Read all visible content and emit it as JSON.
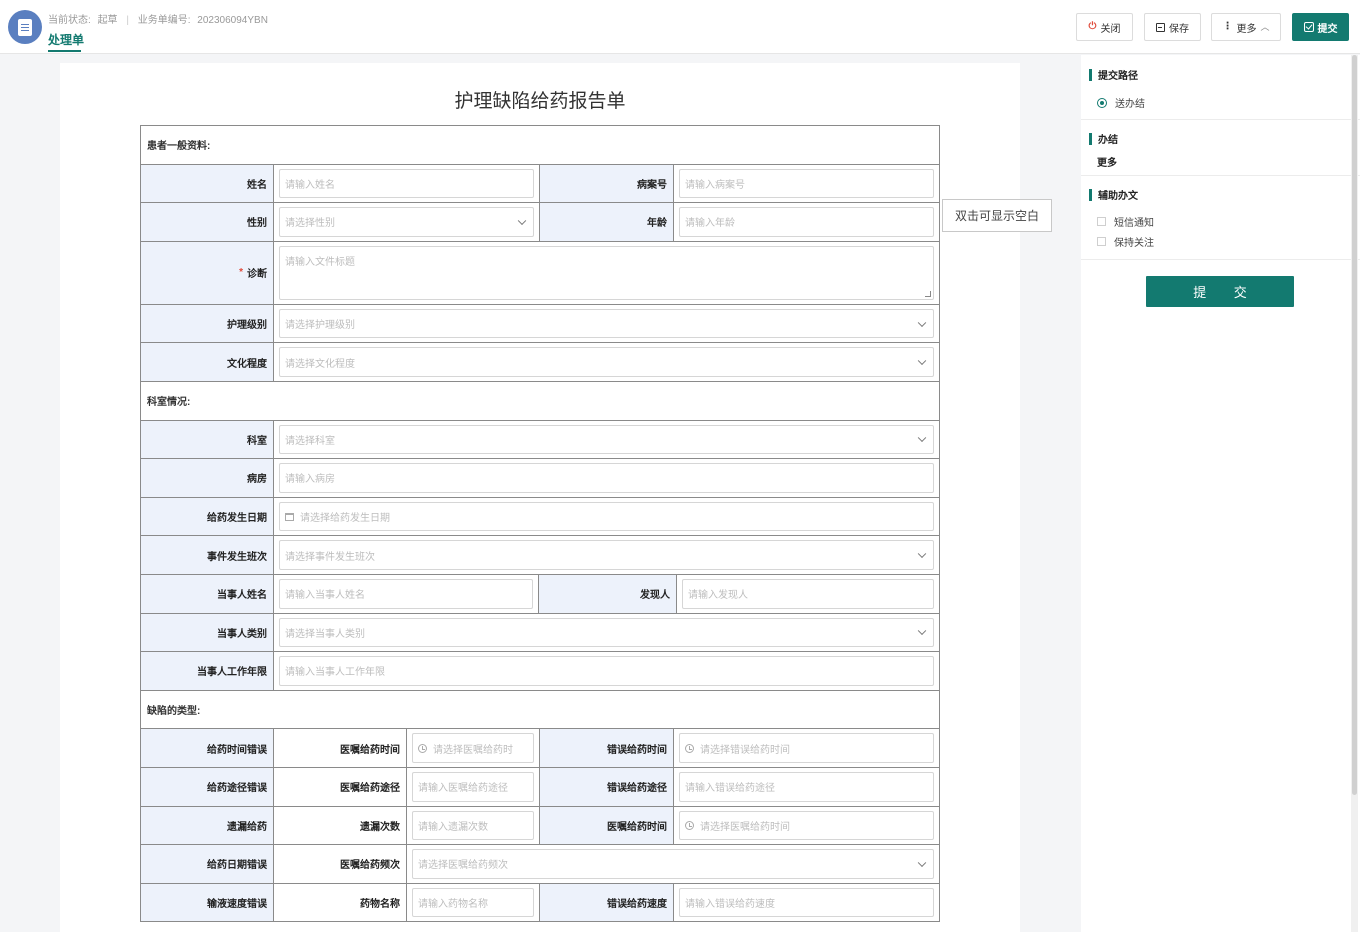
{
  "header": {
    "status_label": "当前状态:",
    "status_value": "起草",
    "doc_no_label": "业务单编号:",
    "doc_no_value": "202306094YBN",
    "tab_title": "处理单",
    "buttons": {
      "close": "关闭",
      "save": "保存",
      "more": "更多",
      "submit": "提交"
    }
  },
  "form": {
    "title": "护理缺陷给药报告单",
    "hint": "双击可显示空白",
    "sections": {
      "patient": "患者一般资料:",
      "dept": "科室情况:",
      "defect": "缺陷的类型:"
    },
    "fields": {
      "name": {
        "label": "姓名",
        "placeholder": "请输入姓名"
      },
      "case_no": {
        "label": "病案号",
        "placeholder": "请输入病案号"
      },
      "gender": {
        "label": "性别",
        "placeholder": "请选择性别"
      },
      "age": {
        "label": "年龄",
        "placeholder": "请输入年龄"
      },
      "diagnosis": {
        "label": "诊断",
        "required": "*",
        "placeholder": "请输入文件标题"
      },
      "care_level": {
        "label": "护理级别",
        "placeholder": "请选择护理级别"
      },
      "education": {
        "label": "文化程度",
        "placeholder": "请选择文化程度"
      },
      "department": {
        "label": "科室",
        "placeholder": "请选择科室"
      },
      "ward": {
        "label": "病房",
        "placeholder": "请输入病房"
      },
      "med_date": {
        "label": "给药发生日期",
        "placeholder": "请选择给药发生日期"
      },
      "event_shift": {
        "label": "事件发生班次",
        "placeholder": "请选择事件发生班次"
      },
      "party_name": {
        "label": "当事人姓名",
        "placeholder": "请输入当事人姓名"
      },
      "finder": {
        "label": "发现人",
        "placeholder": "请输入发现人"
      },
      "party_type": {
        "label": "当事人类别",
        "placeholder": "请选择当事人类别"
      },
      "party_years": {
        "label": "当事人工作年限",
        "placeholder": "请输入当事人工作年限"
      }
    },
    "defect_rows": [
      {
        "type": "给药时间错误",
        "a_label": "医嘱给药时间",
        "a_placeholder": "请选择医嘱给药时",
        "b_label": "错误给药时间",
        "b_placeholder": "请选择错误给药时间"
      },
      {
        "type": "给药途径错误",
        "a_label": "医嘱给药途径",
        "a_placeholder": "请输入医嘱给药途径",
        "b_label": "错误给药途径",
        "b_placeholder": "请输入错误给药途径"
      },
      {
        "type": "遗漏给药",
        "a_label": "遗漏次数",
        "a_placeholder": "请输入遗漏次数",
        "b_label": "医嘱给药时间",
        "b_placeholder": "请选择医嘱给药时间"
      },
      {
        "type": "给药日期错误",
        "a_label": "医嘱给药频次",
        "a_placeholder": "请选择医嘱给药频次"
      },
      {
        "type": "输液速度错误",
        "a_label": "药物名称",
        "a_placeholder": "请输入药物名称",
        "b_label": "错误给药速度",
        "b_placeholder": "请输入错误给药速度"
      }
    ]
  },
  "panel": {
    "submit_path_title": "提交路径",
    "route_option": "送办结",
    "finish_title": "办结",
    "finish_more": "更多",
    "aux_title": "辅助办文",
    "sms_notify": "短信通知",
    "keep_follow": "保持关注",
    "submit_button": "提 交"
  },
  "colors": {
    "accent": "#137a70",
    "label_bg": "#edf2fb",
    "danger": "#e04a3a"
  },
  "icons": [
    "document-icon",
    "power-icon",
    "save-icon",
    "more-dots-icon",
    "chevron-up-icon",
    "submit-check-icon",
    "chevron-down-icon",
    "calendar-icon",
    "clock-icon"
  ]
}
